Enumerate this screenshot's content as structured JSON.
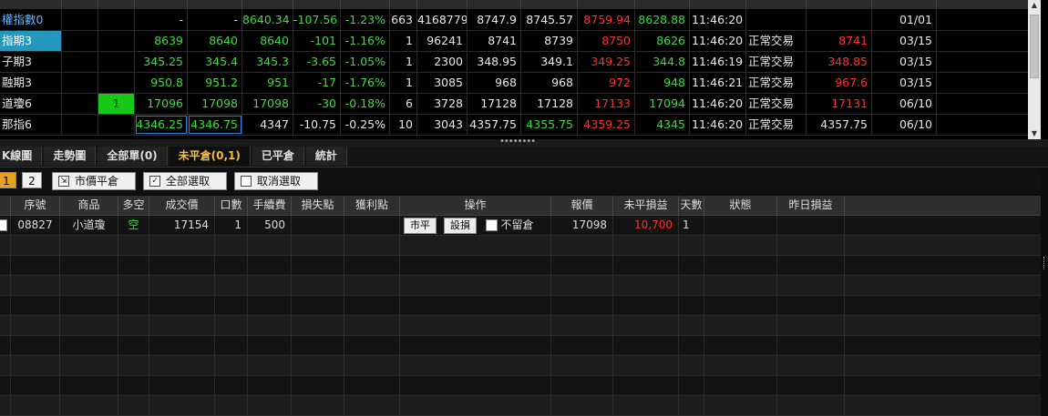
{
  "quote_table": {
    "rows": [
      {
        "name": "權指數0",
        "f1": "",
        "f2": "",
        "bid": "-",
        "ask": "-",
        "last": "8640.34",
        "chg": "-107.56",
        "pct": "-1.23%",
        "vol": "663",
        "total": "4168779",
        "ref": "8747.9",
        "open": "8745.57",
        "high": "8759.94",
        "low": "8628.88",
        "time": "11:46:20",
        "status": "",
        "limit": "",
        "expiry": "01/01"
      },
      {
        "name": "指期3",
        "f1": "",
        "f2": "",
        "bid": "8639",
        "ask": "8640",
        "last": "8640",
        "chg": "-101",
        "pct": "-1.16%",
        "vol": "1",
        "total": "96241",
        "ref": "8741",
        "open": "8739",
        "high": "8750",
        "low": "8626",
        "time": "11:46:20",
        "status": "正常交易",
        "limit": "8741",
        "expiry": "03/15"
      },
      {
        "name": "子期3",
        "f1": "",
        "f2": "",
        "bid": "345.25",
        "ask": "345.4",
        "last": "345.3",
        "chg": "-3.65",
        "pct": "-1.05%",
        "vol": "1",
        "total": "2300",
        "ref": "348.95",
        "open": "349.1",
        "high": "349.25",
        "low": "344.8",
        "time": "11:46:19",
        "status": "正常交易",
        "limit": "348.85",
        "expiry": "03/15"
      },
      {
        "name": "融期3",
        "f1": "",
        "f2": "",
        "bid": "950.8",
        "ask": "951.2",
        "last": "951",
        "chg": "-17",
        "pct": "-1.76%",
        "vol": "1",
        "total": "3085",
        "ref": "968",
        "open": "968",
        "high": "972",
        "low": "948",
        "time": "11:46:21",
        "status": "正常交易",
        "limit": "967.6",
        "expiry": "03/15"
      },
      {
        "name": "道瓊6",
        "f1": "",
        "f2": "1",
        "bid": "17096",
        "ask": "17098",
        "last": "17098",
        "chg": "-30",
        "pct": "-0.18%",
        "vol": "6",
        "total": "3728",
        "ref": "17128",
        "open": "17128",
        "high": "17133",
        "low": "17094",
        "time": "11:46:20",
        "status": "正常交易",
        "limit": "17131",
        "expiry": "06/10"
      },
      {
        "name": "那指6",
        "f1": "",
        "f2": "",
        "bid": "4346.25",
        "ask": "4346.75",
        "last": "4347",
        "chg": "-10.75",
        "pct": "-0.25%",
        "vol": "10",
        "total": "3043",
        "ref": "4357.75",
        "open": "4355.75",
        "high": "4359.25",
        "low": "4345",
        "time": "11:46:20",
        "status": "正常交易",
        "limit": "4357.75",
        "expiry": "06/10"
      }
    ]
  },
  "tabs": [
    "K線圖",
    "走勢圖",
    "全部單(0)",
    "未平倉(0,1)",
    "已平倉",
    "統計"
  ],
  "active_tab_index": 3,
  "toolbar": {
    "page1": "1",
    "page2": "2",
    "market_close": "市價平倉",
    "select_all": "全部選取",
    "deselect": "取消選取"
  },
  "positions": {
    "headers": [
      "",
      "序號",
      "商品",
      "多空",
      "成交價",
      "口數",
      "手續費",
      "損失點",
      "獲利點",
      "操作",
      "報價",
      "未平損益",
      "天數",
      "狀態",
      "昨日損益"
    ],
    "row": {
      "seq": "08827",
      "product": "小道瓊",
      "side": "空",
      "price": "17154",
      "lots": "1",
      "fee": "500",
      "stop_loss": "",
      "take_profit": "",
      "btn_close": "市平",
      "btn_set": "設損",
      "keep_label": "不留倉",
      "quote": "17098",
      "unrealized": "10,700",
      "days": "1",
      "state": "",
      "prev": ""
    }
  },
  "colors": {
    "up": "#ff3030",
    "down": "#3fdc3f",
    "accent": "#f0c040",
    "selected": "#2596be"
  }
}
